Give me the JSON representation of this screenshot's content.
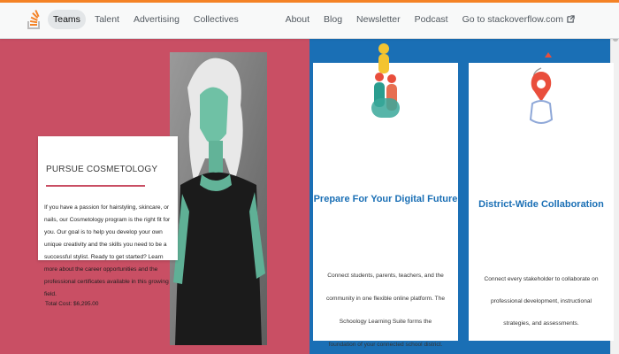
{
  "nav": {
    "left": [
      "Teams",
      "Talent",
      "Advertising",
      "Collectives"
    ],
    "right": [
      "About",
      "Blog",
      "Newsletter",
      "Podcast",
      "Go to stackoverflow.com"
    ],
    "icons": {
      "logo": "stackoverflow-logo-icon",
      "external": "external-link-icon"
    },
    "colors": {
      "accent": "#f48225"
    }
  },
  "left": {
    "title": "PURSUE COSMETOLOGY",
    "body": "If you have a passion for hairstyling, skincare, or nails, our Cosmetology program is the right fit for you. Our goal is to help you develop your own unique creativity and the skills you need to be a successful stylist. Ready to get started? Learn more about the career opportunities and the professional certificates available in this growing field.",
    "meta": "Total Cost: $6,295.00",
    "colors": {
      "background": "#c94f64"
    }
  },
  "right": {
    "colors": {
      "background": "#1a6fb5",
      "title": "#1a6fb5"
    },
    "cards": [
      {
        "title": "Prepare For Your Digital Future",
        "text": "Connect students, parents, teachers, and the community in one flexible online platform. The Schoology Learning Suite forms the foundation of your connected school district."
      },
      {
        "title": "District-Wide Collaboration",
        "text": "Connect every stakeholder to collaborate on professional development, instructional strategies, and assessments."
      }
    ]
  }
}
